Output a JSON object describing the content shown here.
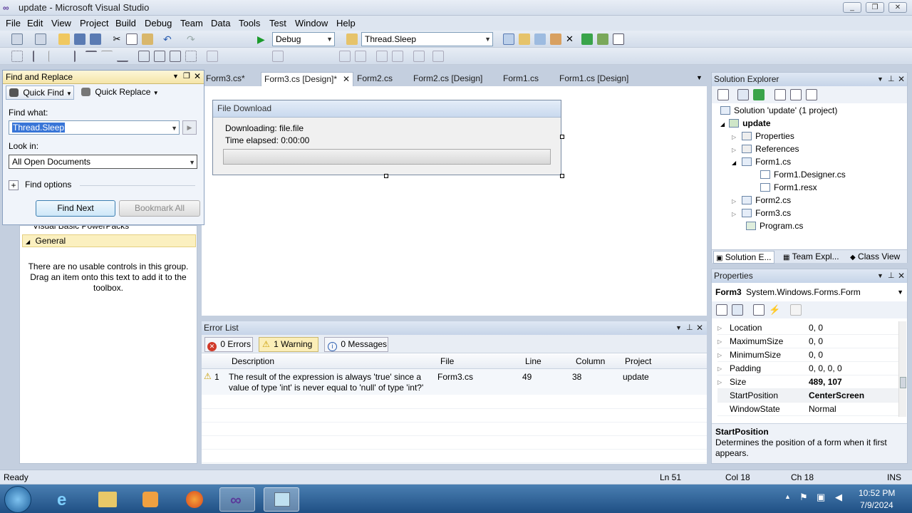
{
  "window": {
    "title": "update - Microsoft Visual Studio"
  },
  "menu": [
    "File",
    "Edit",
    "View",
    "Project",
    "Build",
    "Debug",
    "Team",
    "Data",
    "Tools",
    "Test",
    "Window",
    "Help"
  ],
  "toolbar": {
    "config": "Debug",
    "find_combo": "Thread.Sleep"
  },
  "doc_tabs": [
    {
      "label": "Form3.cs*"
    },
    {
      "label": "Form3.cs [Design]*",
      "active": true
    },
    {
      "label": "Form2.cs"
    },
    {
      "label": "Form2.cs [Design]"
    },
    {
      "label": "Form1.cs"
    },
    {
      "label": "Form1.cs [Design]"
    }
  ],
  "designer": {
    "form_caption": "File Download",
    "line1": "Downloading: file.file",
    "line2": "Time elapsed: 0:00:00",
    "progress": 0
  },
  "find": {
    "title": "Find and Replace",
    "quick_find": "Quick Find",
    "quick_replace": "Quick Replace",
    "find_what_label": "Find what:",
    "find_what_value": "Thread.Sleep",
    "look_in_label": "Look in:",
    "look_in_value": "All Open Documents",
    "find_options": "Find options",
    "find_next": "Find Next",
    "bookmark_all": "Bookmark All"
  },
  "toolbox": {
    "partial_group": "Visual Basic PowerPacks",
    "group": "General",
    "empty_text": "There are no usable controls in this group. Drag an item onto this text to add it to the toolbox."
  },
  "error_list": {
    "title": "Error List",
    "errors": "0 Errors",
    "warnings": "1 Warning",
    "messages": "0 Messages",
    "columns": [
      "Description",
      "File",
      "Line",
      "Column",
      "Project"
    ],
    "rows": [
      {
        "num": "1",
        "description": "The result of the expression is always 'true' since a value of type 'int' is never equal to 'null' of type 'int?'",
        "file": "Form3.cs",
        "line": "49",
        "column": "38",
        "project": "update"
      }
    ]
  },
  "solution_explorer": {
    "title": "Solution Explorer",
    "items": [
      "Solution 'update' (1 project)",
      "update",
      "Properties",
      "References",
      "Form1.cs",
      "Form1.Designer.cs",
      "Form1.resx",
      "Form2.cs",
      "Form3.cs",
      "Program.cs"
    ],
    "tabs": [
      "Solution E...",
      "Team Expl...",
      "Class View"
    ]
  },
  "properties": {
    "title": "Properties",
    "object": "Form3",
    "object_type": "System.Windows.Forms.Form",
    "rows": [
      {
        "name": "Location",
        "value": "0, 0"
      },
      {
        "name": "MaximumSize",
        "value": "0, 0"
      },
      {
        "name": "MinimumSize",
        "value": "0, 0"
      },
      {
        "name": "Padding",
        "value": "0, 0, 0, 0"
      },
      {
        "name": "Size",
        "value": "489, 107",
        "bold": true
      },
      {
        "name": "StartPosition",
        "value": "CenterScreen",
        "bold": true,
        "selected": true
      },
      {
        "name": "WindowState",
        "value": "Normal"
      }
    ],
    "desc_title": "StartPosition",
    "desc_text": "Determines the position of a form when it first appears."
  },
  "status": {
    "ready": "Ready",
    "ln": "Ln 51",
    "col": "Col 18",
    "ch": "Ch 18",
    "mode": "INS"
  },
  "taskbar": {
    "time": "10:52 PM",
    "date": "7/9/2024"
  },
  "colors": {
    "accent": "#1f4f84",
    "warning": "#e8c33a",
    "error": "#d03a2a"
  }
}
